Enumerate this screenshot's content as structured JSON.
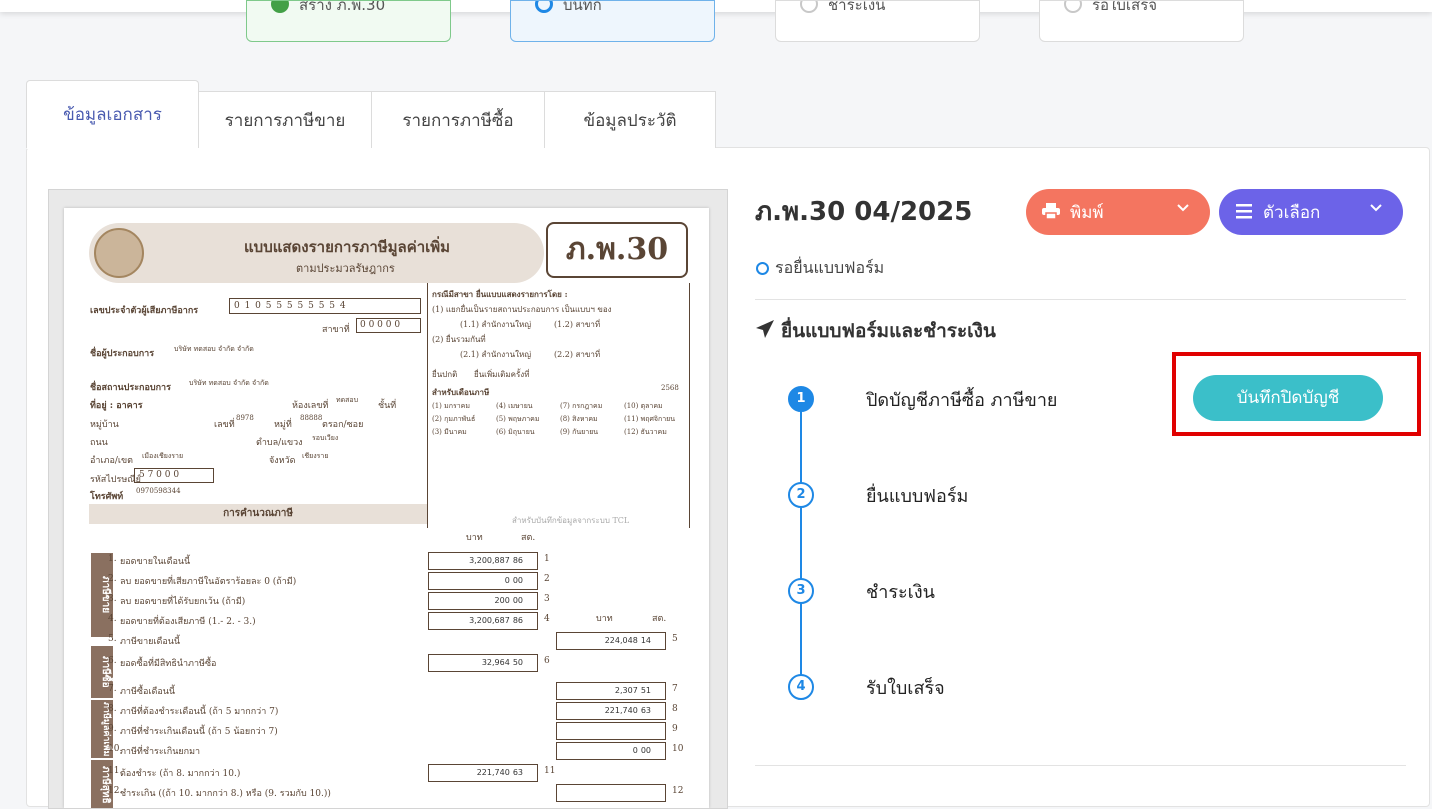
{
  "steps": [
    {
      "label": "สร้าง ภ.พ.30",
      "state": "done"
    },
    {
      "label": "บันทึก",
      "state": "current"
    },
    {
      "label": "ชำระเงิน",
      "state": "pending"
    },
    {
      "label": "รอใบเสร็จ",
      "state": "pending"
    }
  ],
  "tabs": [
    "ข้อมูลเอกสาร",
    "รายการภาษีขาย",
    "รายการภาษีซื้อ",
    "ข้อมูลประวัติ"
  ],
  "doc": {
    "title": "ภ.พ.30 04/2025",
    "status": "รอยื่นแบบฟอร์ม",
    "print_label": "พิมพ์",
    "options_label": "ตัวเลือก"
  },
  "section_title": "ยื่นแบบฟอร์มและชำระเงิน",
  "timeline": [
    {
      "num": "1",
      "label": "ปิดบัญชีภาษีซื้อ ภาษีขาย",
      "action": "บันทึกปิดบัญชี"
    },
    {
      "num": "2",
      "label": "ยื่นแบบฟอร์ม"
    },
    {
      "num": "3",
      "label": "ชำระเงิน"
    },
    {
      "num": "4",
      "label": "รับใบเสร็จ"
    }
  ],
  "form": {
    "heading": "แบบแสดงรายการภาษีมูลค่าเพิ่ม",
    "subheading": "ตามประมวลรัษฎากร",
    "code": "ภ.พ.30",
    "tax_id_label": "เลขประจำตัวผู้เสียภาษีอากร",
    "tax_id": "0 1 0 5 5 5 5 5 5 5 4",
    "branch_label": "สาขาที่",
    "branch": "0 0 0 0 0",
    "operator_label": "ชื่อผู้ประกอบการ",
    "operator": "บริษัท ทดสอบ จำกัด จำกัด",
    "place_label": "ชื่อสถานประกอบการ",
    "place": "บริษัท ทดสอบ จำกัด จำกัด",
    "address_label": "ที่อยู่ : อาคาร",
    "room_label": "ห้องเลขที่",
    "room": "ทดสอบ",
    "floor_label": "ชั้นที่",
    "village_label": "หมู่บ้าน",
    "house_no_label": "เลขที่",
    "house_no": "8978",
    "moo_label": "หมู่ที่",
    "moo": "88888",
    "soi_label": "ตรอก/ซอย",
    "road_label": "ถนน",
    "subdistrict_label": "ตำบล/แขวง",
    "subdistrict": "รอบเวียง",
    "district_label": "อำเภอ/เขต",
    "district": "เมืองเชียงราย",
    "province_label": "จังหวัด",
    "province": "เชียงราย",
    "postcode_label": "รหัสไปรษณีย์",
    "postcode": "5 7 0 0 0",
    "phone_label": "โทรศัพท์",
    "phone": "0970598344",
    "branch_case": "กรณีมีสาขา ยื่นแบบแสดงรายการโดย :",
    "opt1": "(1) แยกยื่นเป็นรายสถานประกอบการ เป็นแบบฯ ของ",
    "opt11": "(1.1) สำนักงานใหญ่",
    "opt12": "(1.2) สาขาที่",
    "opt2": "(2) ยื่นรวมกันที่",
    "opt21": "(2.1) สำนักงานใหญ่",
    "opt22": "(2.2) สาขาที่",
    "filing": "ยื่นปกติ",
    "filing_extra": "ยื่นเพิ่มเติมครั้งที่",
    "month_label": "สำหรับเดือนภาษี",
    "year": "2568",
    "months": [
      "(1) มกราคม",
      "(4) เมษายน",
      "(7) กรกฎาคม",
      "(10) ตุลาคม",
      "(2) กุมภาพันธ์",
      "(5) พฤษภาคม",
      "(8) สิงหาคม",
      "(11) พฤศจิกายน",
      "(3) มีนาคม",
      "(6) มิถุนายน",
      "(9) กันยายน",
      "(12) ธันวาคม"
    ],
    "tcl_note": "สำหรับบันทึกข้อมูลจากระบบ TCL",
    "calc_title": "การคำนวณภาษี",
    "baht": "บาท",
    "satang": "สต.",
    "side_sale": "ภาษีขาย",
    "side_buy": "ภาษีซื้อ",
    "side_vat": "ภาษีมูลค่าเพิ่ม",
    "side_net": "ภาษีสุทธิ",
    "lines": [
      {
        "n": "1.",
        "label": "ยอดขายในเดือนนี้",
        "amount": "3,200,887",
        "st": "86",
        "no": "1"
      },
      {
        "n": "2.",
        "label": "ลบ ยอดขายที่เสียภาษีในอัตราร้อยละ 0 (ถ้ามี)",
        "amount": "0",
        "st": "00",
        "no": "2"
      },
      {
        "n": "3.",
        "label": "ลบ ยอดขายที่ได้รับยกเว้น (ถ้ามี)",
        "amount": "200",
        "st": "00",
        "no": "3"
      },
      {
        "n": "4.",
        "label": "ยอดขายที่ต้องเสียภาษี (1.- 2. - 3.)",
        "amount": "3,200,687",
        "st": "86",
        "no": "4"
      },
      {
        "n": "5.",
        "label": "ภาษีขายเดือนนี้",
        "amount": "224,048",
        "st": "14",
        "no": "5"
      },
      {
        "n": "6.",
        "label": "ยอดซื้อที่มีสิทธินำภาษีซื้อ",
        "amount": "32,964",
        "st": "50",
        "no": "6"
      },
      {
        "n": "7.",
        "label": "ภาษีซื้อเดือนนี้",
        "amount": "2,307",
        "st": "51",
        "no": "7"
      },
      {
        "n": "8.",
        "label": "ภาษีที่ต้องชำระเดือนนี้ (ถ้า 5 มากกว่า 7)",
        "amount": "221,740",
        "st": "63",
        "no": "8"
      },
      {
        "n": "9.",
        "label": "ภาษีที่ชำระเกินเดือนนี้ (ถ้า 5 น้อยกว่า 7)",
        "amount": "",
        "st": "",
        "no": "9"
      },
      {
        "n": "10.",
        "label": "ภาษีที่ชำระเกินยกมา",
        "amount": "0",
        "st": "00",
        "no": "10"
      },
      {
        "n": "11.",
        "label": "ต้องชำระ (ถ้า 8. มากกว่า 10.)",
        "amount": "221,740",
        "st": "63",
        "no": "11"
      },
      {
        "n": "12.",
        "label": "ชำระเกิน ((ถ้า 10. มากกว่า 8.) หรือ (9. รวมกับ 10.))",
        "amount": "",
        "st": "",
        "no": "12"
      }
    ]
  }
}
